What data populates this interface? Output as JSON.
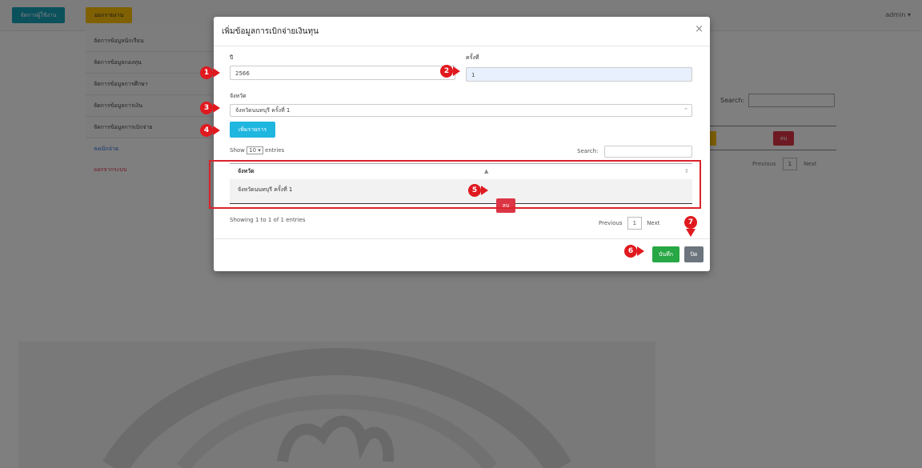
{
  "topbar": {
    "teal_button": "จัดการผู้ใช้งาน",
    "yellow_button": "ออกรายงาน",
    "admin_label": "admin ▾"
  },
  "sidebar": {
    "items": [
      {
        "label": "จัดการข้อมูลนักเรียน"
      },
      {
        "label": "จัดการข้อมูลกองทุน"
      },
      {
        "label": "จัดการข้อมูลการศึกษา"
      },
      {
        "label": "จัดการข้อมูลการเงิน"
      },
      {
        "label": "จัดการข้อมูลการเบิกจ่าย"
      }
    ],
    "link_blue": "ลงเบิกจ่าย",
    "link_red": "ออกจากระบบ"
  },
  "background_table": {
    "search_label": "Search:",
    "delete_label": "ลบ",
    "prev_label": "Previous",
    "page_label": "1",
    "next_label": "Next"
  },
  "modal": {
    "title": "เพิ่มข้อมูลการเบิกจ่ายเงินทุน",
    "year_label": "ปี",
    "year_value": "2566",
    "round_label": "ครั้งที่",
    "round_value": "1",
    "province_label": "จังหวัด",
    "province_value": "จังหวัดนนทบุรี ครั้งที่ 1",
    "add_button": "เพิ่มรายการ",
    "show_label": "Show",
    "entries_value": "10",
    "entries_label": "entries",
    "search_label": "Search:",
    "table_header": "จังหวัด",
    "table_rows": [
      {
        "province": "จังหวัดนนทบุรี ครั้งที่ 1",
        "delete": "ลบ"
      }
    ],
    "showing_text": "Showing 1 to 1 of 1 entries",
    "prev_label": "Previous",
    "page_label": "1",
    "next_label": "Next",
    "save_button": "บันทึก",
    "close_button": "ปิด"
  },
  "markers": [
    "1",
    "2",
    "3",
    "4",
    "5",
    "6",
    "7"
  ],
  "colors": {
    "accent_red": "#e0191f",
    "save_green": "#28a745",
    "add_cyan": "#1fb6e0",
    "delete_red": "#dc3545",
    "close_gray": "#6c757d"
  }
}
